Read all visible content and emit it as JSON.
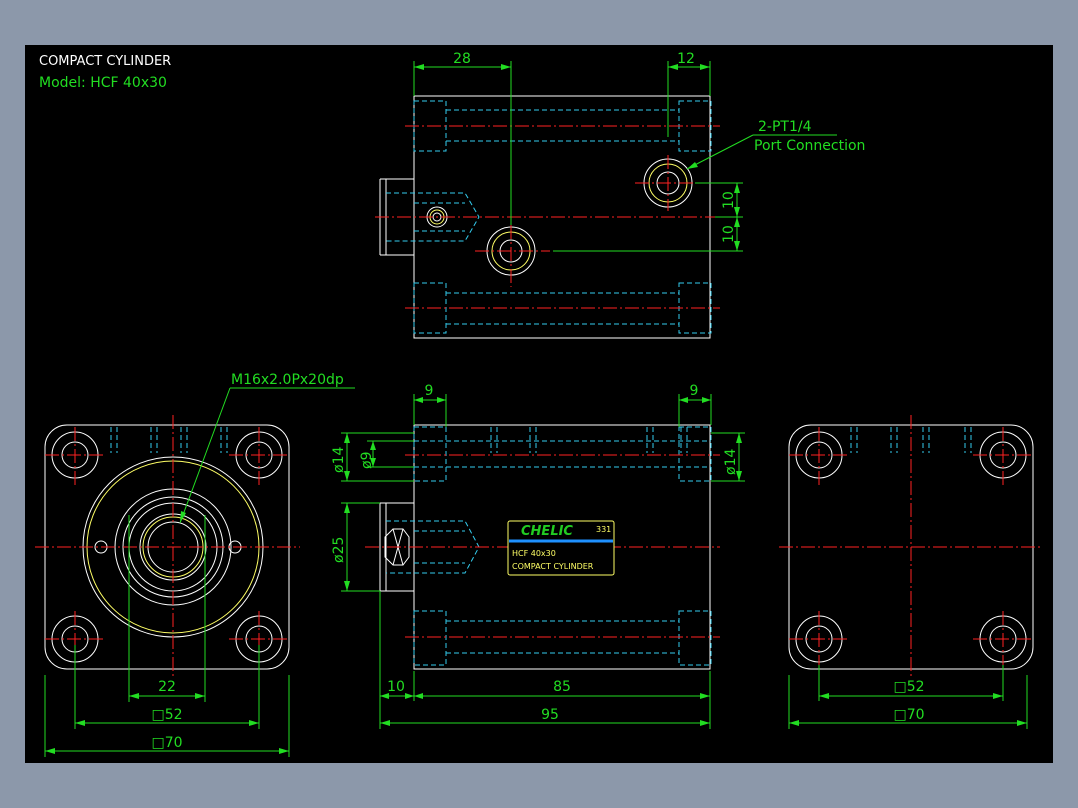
{
  "title_block": {
    "title": "COMPACT CYLINDER",
    "model": "Model:  HCF 40x30"
  },
  "top_view": {
    "dim_left": "28",
    "dim_right": "12",
    "port_label": "2-PT1/4",
    "port_sublabel": "Port Connection",
    "dim_v1": "10",
    "dim_v2": "10"
  },
  "front_view": {
    "thread_label": "M16x2.0Px20dp",
    "dim_22": "22",
    "dim_52": "□52",
    "dim_70": "□70"
  },
  "side_view": {
    "dim_9_left": "9",
    "dim_9_right": "9",
    "dia_14_left": "ø14",
    "dia_9": "ø9",
    "dia_14_right": "ø14",
    "dia_25": "ø25",
    "dim_10": "10",
    "dim_85": "85",
    "dim_95": "95"
  },
  "nameplate": {
    "brand": "CHELIC",
    "code": "331",
    "model": "HCF 40x30",
    "name": "COMPACT CYLINDER",
    "brand_color": "#22cc22",
    "bar_color": "#1e90ff"
  },
  "rear_view": {
    "dim_52": "□52",
    "dim_70": "□70"
  },
  "colors": {
    "background": "#000000",
    "outline": "#ffffff",
    "hidden": "#33ccee",
    "centerline": "#ff2222",
    "dimension": "#22dd22",
    "thread": "#ffff66"
  }
}
